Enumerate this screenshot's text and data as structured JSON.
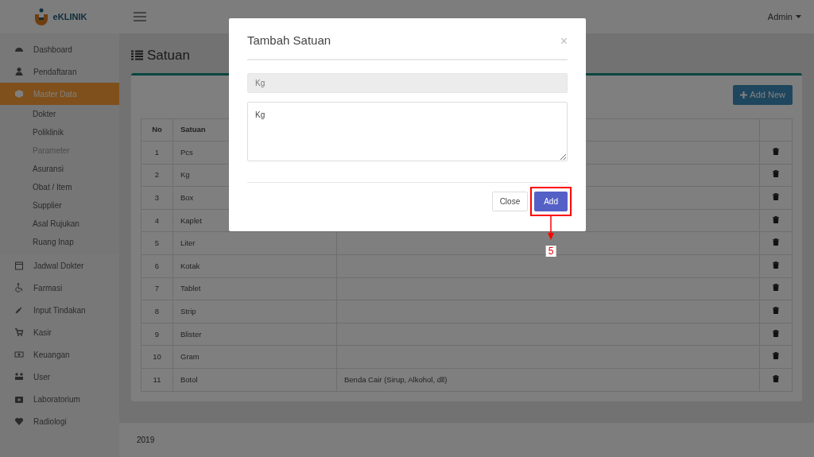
{
  "brand": {
    "name": "eKLINIK"
  },
  "sidebar": {
    "items": [
      {
        "label": "Dashboard",
        "selected": false
      },
      {
        "label": "Pendaftaran",
        "selected": false
      },
      {
        "label": "Master Data",
        "selected": true,
        "expanded": true,
        "children": [
          {
            "label": "Dokter",
            "disabled": false
          },
          {
            "label": "Poliklinik",
            "disabled": false
          },
          {
            "label": "Parameter",
            "disabled": true
          },
          {
            "label": "Asuransi",
            "disabled": false
          },
          {
            "label": "Obat / Item",
            "disabled": false
          },
          {
            "label": "Supplier",
            "disabled": false
          },
          {
            "label": "Asal Rujukan",
            "disabled": false
          },
          {
            "label": "Ruang Inap",
            "disabled": false
          }
        ]
      },
      {
        "label": "Jadwal Dokter",
        "selected": false
      },
      {
        "label": "Farmasi",
        "selected": false
      },
      {
        "label": "Input Tindakan",
        "selected": false
      },
      {
        "label": "Kasir",
        "selected": false
      },
      {
        "label": "Keuangan",
        "selected": false
      },
      {
        "label": "User",
        "selected": false
      },
      {
        "label": "Laboratorium",
        "selected": false
      },
      {
        "label": "Radiologi",
        "selected": false
      }
    ]
  },
  "header": {
    "user": "Admin"
  },
  "page": {
    "title": "Satuan",
    "add_button": "Add New"
  },
  "table": {
    "columns": [
      "No",
      "Satuan"
    ],
    "rows": [
      {
        "no": "1",
        "satuan": "Pcs"
      },
      {
        "no": "2",
        "satuan": "Kg"
      },
      {
        "no": "3",
        "satuan": "Box"
      },
      {
        "no": "4",
        "satuan": "Kaplet"
      },
      {
        "no": "5",
        "satuan": "Liter"
      },
      {
        "no": "6",
        "satuan": "Kotak"
      },
      {
        "no": "7",
        "satuan": "Tablet"
      },
      {
        "no": "8",
        "satuan": "Strip"
      },
      {
        "no": "9",
        "satuan": "Blister"
      },
      {
        "no": "10",
        "satuan": "Gram"
      },
      {
        "no": "11",
        "satuan": "Botol",
        "keterangan": "Benda Cair (Sirup, Alkohol, dll)"
      }
    ]
  },
  "footer": {
    "text": "2019"
  },
  "modal": {
    "title": "Tambah Satuan",
    "close": "×",
    "fields": [
      {
        "kind": "input",
        "value": "Kg",
        "disabled": true
      },
      {
        "kind": "textarea",
        "value": "Kg",
        "disabled": false
      }
    ],
    "buttons": [
      {
        "label": "Close",
        "kind": "default"
      },
      {
        "label": "Add",
        "kind": "primary",
        "highlighted": true
      }
    ],
    "annotation": {
      "label": "5"
    }
  }
}
